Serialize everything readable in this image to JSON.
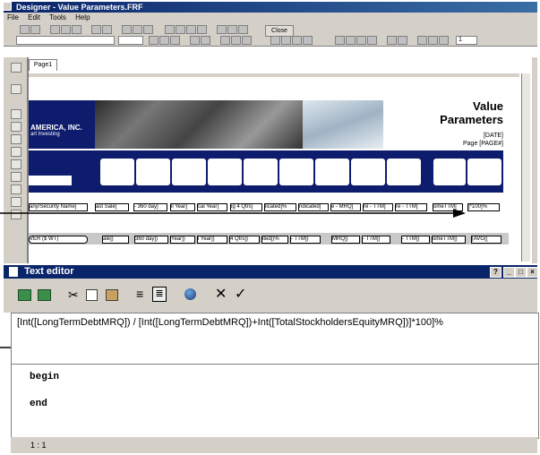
{
  "window": {
    "title": "Designer - Value Parameters.FRF"
  },
  "menu": [
    "File",
    "Edit",
    "Tools",
    "Help"
  ],
  "toolbar": {
    "close_label": "Close",
    "zoom_value": "1"
  },
  "report": {
    "tab": "Page1",
    "title_line1": "Value",
    "title_line2": "Parameters",
    "date": "[DATE]",
    "page": "Page [PAGE#]",
    "logo_line1": "AMERICA, INC.",
    "logo_line2": "art Investing"
  },
  "detail_row": [
    "any/Security Name]",
    "ast Sale]",
    "- 360 day]",
    "il Year]",
    "cal Year]",
    "ig 4 Qtrs]",
    "licated]%",
    "ndicated]",
    "e - MRQ]",
    "re - TTM]",
    "re - TTM]",
    "omeTTM]",
    "]*100]%"
  ],
  "summary_row": [
    "VER ($ WT)",
    "ale])",
    "360 day])",
    "Year])",
    "l Year])",
    "4 Qtrs])",
    "ited])%",
    "- TTM])",
    "MRQ])",
    "- TTM])",
    "- TTM])",
    "omeTTM])",
    "[AVG(["
  ],
  "text_editor": {
    "title": "Text editor",
    "formula": "[Int([LongTermDebtMRQ]) / [Int([LongTermDebtMRQ])+Int([TotalStockholdersEquityMRQ])]*100]%",
    "code_begin": "begin",
    "code_end": "end",
    "status": "1 : 1",
    "help_label": "?",
    "min_label": "_",
    "max_label": "□",
    "close_label": "×"
  },
  "colors": {
    "title_bar": "#0a246a",
    "report_band": "#0e1c6e",
    "face": "#d4d0c8"
  }
}
